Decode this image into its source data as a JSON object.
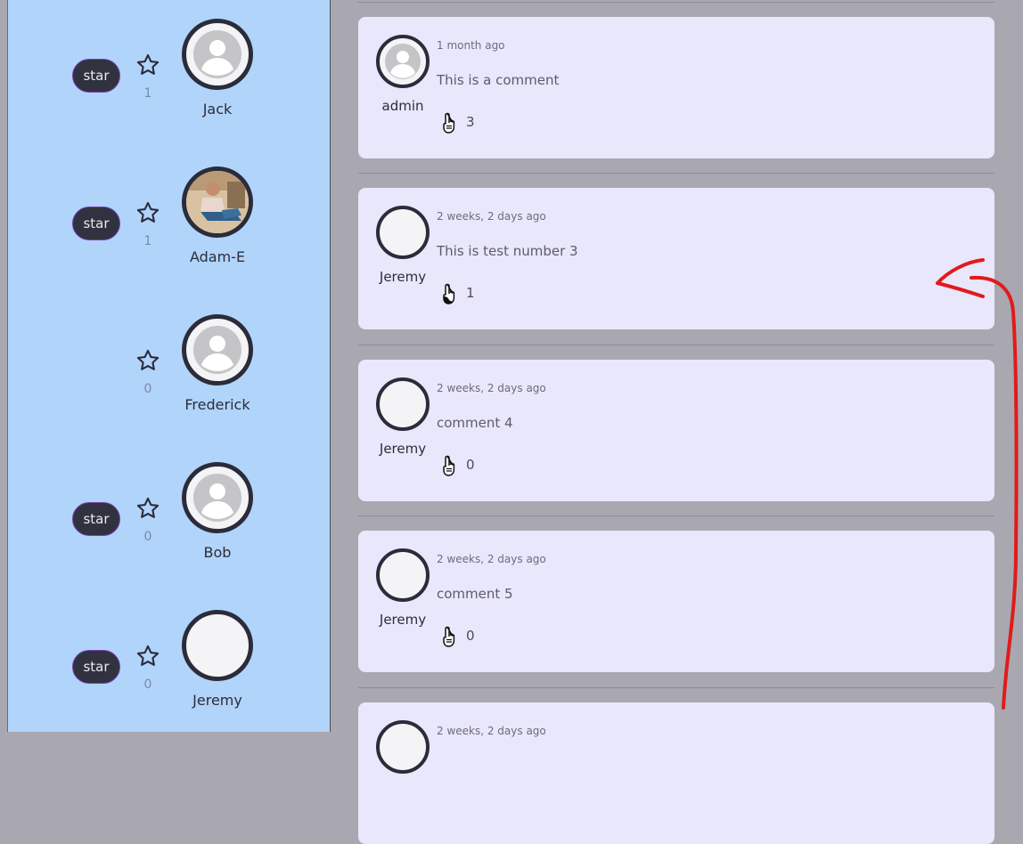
{
  "users": [
    {
      "star_label": "star",
      "count": "1",
      "name": "Jack",
      "has_star_button": true,
      "avatar_type": "default-avatar"
    },
    {
      "star_label": "star",
      "count": "1",
      "name": "Adam-E",
      "has_star_button": true,
      "avatar_type": "photo"
    },
    {
      "star_label": "",
      "count": "0",
      "name": "Frederick",
      "has_star_button": false,
      "avatar_type": "default-avatar"
    },
    {
      "star_label": "star",
      "count": "0",
      "name": "Bob",
      "has_star_button": true,
      "avatar_type": "default-avatar"
    },
    {
      "star_label": "star",
      "count": "0",
      "name": "Jeremy",
      "has_star_button": true,
      "avatar_type": "blank"
    }
  ],
  "comments": [
    {
      "author": "admin",
      "time": "1 month ago",
      "text": "This is a comment",
      "likes": "3",
      "avatar_type": "default-avatar",
      "like_icon": "pointing-hand-icon"
    },
    {
      "author": "Jeremy",
      "time": "2 weeks, 2 days ago",
      "text": "This is test number 3",
      "likes": "1",
      "avatar_type": "blank",
      "like_icon": "pointing-hand-filled-icon"
    },
    {
      "author": "Jeremy",
      "time": "2 weeks, 2 days ago",
      "text": "comment 4",
      "likes": "0",
      "avatar_type": "blank",
      "like_icon": "pointing-hand-icon"
    },
    {
      "author": "Jeremy",
      "time": "2 weeks, 2 days ago",
      "text": "comment 5",
      "likes": "0",
      "avatar_type": "blank",
      "like_icon": "pointing-hand-icon"
    },
    {
      "author": "",
      "time": "2 weeks, 2 days ago",
      "text": "",
      "likes": "",
      "avatar_type": "blank",
      "like_icon": ""
    }
  ],
  "colors": {
    "sidebar_bg": "#b1d4fb",
    "page_bg": "#a9a8b1",
    "card_bg": "#e9e7fb",
    "star_button_bg": "#31323f",
    "star_button_border": "#7b3fb5",
    "annotation_red": "#e01b1b"
  }
}
